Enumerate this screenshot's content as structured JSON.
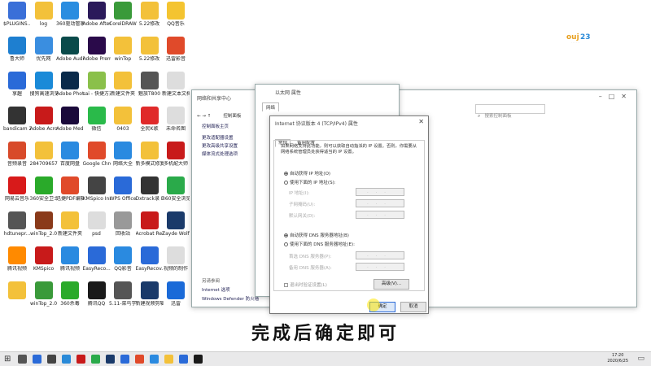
{
  "desktop": {
    "icons": [
      {
        "label": "$PLUGINS...",
        "color": "#3a6fd8"
      },
      {
        "label": "log",
        "color": "#f3c13a"
      },
      {
        "label": "360驱动管家",
        "color": "#2a8de0"
      },
      {
        "label": "Adobe After Effects CC ...",
        "color": "#2b1a5a"
      },
      {
        "label": "CorelDRAW X7",
        "color": "#3a9a3a"
      },
      {
        "label": "5.22修改",
        "color": "#f3c13a"
      },
      {
        "label": "QQ音乐",
        "color": "#f4c430"
      },
      {
        "label": "鲁大师",
        "color": "#1e7fd0"
      },
      {
        "label": "优先网",
        "color": "#3a8ee0"
      },
      {
        "label": "Adobe Audition ...",
        "color": "#0a4a4a"
      },
      {
        "label": "Adobe Premiere P...",
        "color": "#2a0a4a"
      },
      {
        "label": "winTop",
        "color": "#f3c13a"
      },
      {
        "label": "5.22修改",
        "color": "#f3c13a"
      },
      {
        "label": "迅雷影音",
        "color": "#e04a2a"
      },
      {
        "label": "享趣",
        "color": "#2a6ad8"
      },
      {
        "label": "搜狗高速浏览器",
        "color": "#1a8ad8"
      },
      {
        "label": "Adobe Photosh...",
        "color": "#0a2a4a"
      },
      {
        "label": "sai - 快捷方式",
        "color": "#8ac04a"
      },
      {
        "label": "新建文件夹",
        "color": "#f3c13a"
      },
      {
        "label": "魅族T800",
        "color": "#555"
      },
      {
        "label": "新建文本文档",
        "color": "#ddd"
      },
      {
        "label": "bandicam 2020-06-0...",
        "color": "#333"
      },
      {
        "label": "Adobe Acrobat DC",
        "color": "#c81a1a"
      },
      {
        "label": "Adobe Media En...",
        "color": "#1a0a3a"
      },
      {
        "label": "微信",
        "color": "#2aba4a"
      },
      {
        "label": "0403",
        "color": "#f3c13a"
      },
      {
        "label": "全民K歌",
        "color": "#e02a2a"
      },
      {
        "label": "未命名图",
        "color": "#ddd"
      },
      {
        "label": "音频录音",
        "color": "#d84a2a"
      },
      {
        "label": "2847096573",
        "color": "#f3c13a"
      },
      {
        "label": "百度网盘",
        "color": "#2a8ae0"
      },
      {
        "label": "Google Chrome",
        "color": "#e04a2a"
      },
      {
        "label": "网络大全",
        "color": "#2a8ae0"
      },
      {
        "label": "新多模式修复",
        "color": "#f3c13a"
      },
      {
        "label": "多机配大师",
        "color": "#c81a1a"
      },
      {
        "label": "网易云音乐",
        "color": "#d81a1a"
      },
      {
        "label": "360安全卫士",
        "color": "#2aaa2a"
      },
      {
        "label": "迅捷PDF编辑器",
        "color": "#e04a2a"
      },
      {
        "label": "KMSpico Install",
        "color": "#444"
      },
      {
        "label": "WPS Office",
        "color": "#2a6ad8"
      },
      {
        "label": "Dxtrack录 EasyReco...",
        "color": "#333"
      },
      {
        "label": "360安全浏览器",
        "color": "#2aaa4a"
      },
      {
        "label": "hdtunepr...",
        "color": "#555"
      },
      {
        "label": "winTop_2.0",
        "color": "#8a3a1a"
      },
      {
        "label": "新建文件夹",
        "color": "#f3c13a"
      },
      {
        "label": "psd",
        "color": "#ddd"
      },
      {
        "label": "回收站",
        "color": "#999"
      },
      {
        "label": "Acrobat Reader DC",
        "color": "#c81a1a"
      },
      {
        "label": "Zayde Wolf - Gladiator",
        "color": "#1a3a6a"
      },
      {
        "label": "腾讯视频",
        "color": "#ff8a00"
      },
      {
        "label": "KMSpico",
        "color": "#c81a1a"
      },
      {
        "label": "腾讯视频",
        "color": "#2a8ae0"
      },
      {
        "label": "EasyReco...",
        "color": "#2a6ad8"
      },
      {
        "label": "QQ影音",
        "color": "#2a8ae0"
      },
      {
        "label": "EasyRecov...",
        "color": "#2a6ad8"
      },
      {
        "label": "视频的制作",
        "color": "#ddd"
      },
      {
        "label": "",
        "color": "#f3c13a"
      },
      {
        "label": "winTop_2.0",
        "color": "#3a9a3a"
      },
      {
        "label": "360杀毒",
        "color": "#2aaa2a"
      },
      {
        "label": "腾讯QQ",
        "color": "#1a1a1a"
      },
      {
        "label": "5.11-菜鸟学习",
        "color": "#555"
      },
      {
        "label": "新建视频剪辑 操作Beat...",
        "color": "#1a3a6a"
      },
      {
        "label": "迅雷",
        "color": "#1a6ad8"
      }
    ]
  },
  "netcenter": {
    "title": "网络和共享中心",
    "address": "控制面板",
    "search_placeholder": "搜索控制面板",
    "links": [
      "控制面板主页",
      "更改适配器设置",
      "更改高级共享设置",
      "媒体流式处理选项"
    ],
    "see_also_title": "另请参阅",
    "see_also": [
      "Internet 选项",
      "Windows Defender 防火墙"
    ]
  },
  "ethernet": {
    "title": "以太网 属性",
    "tab": "网络"
  },
  "ipv4": {
    "title": "Internet 协议版本 4 (TCP/IPv4) 属性",
    "tabs": [
      "常规",
      "备用配置"
    ],
    "description": "如果网络支持此功能，则可以获取自动指派的 IP 设置。否则，你需要从网络系统管理员处获得适当的 IP 设置。",
    "auto_ip": "自动获得 IP 地址(O)",
    "manual_ip": "使用下面的 IP 地址(S):",
    "ip_label": "IP 地址(I):",
    "mask_label": "子网掩码(U):",
    "gateway_label": "默认网关(D):",
    "auto_dns": "自动获得 DNS 服务器地址(B)",
    "manual_dns": "使用下面的 DNS 服务器地址(E):",
    "dns1_label": "首选 DNS 服务器(P):",
    "dns2_label": "备用 DNS 服务器(A):",
    "validate": "退出时验证设置(L)",
    "advanced": "高级(V)...",
    "ok": "确定",
    "cancel": "取消"
  },
  "subtitle": "完成后确定即可",
  "clock": {
    "time": "17:20",
    "date": "2020/6/25"
  }
}
